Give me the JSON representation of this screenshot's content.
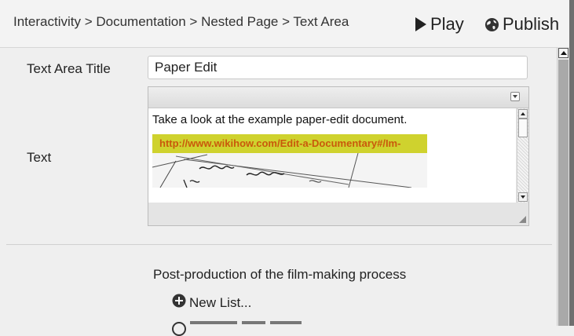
{
  "header": {
    "breadcrumb": "Interactivity > Documentation > Nested Page > Text Area",
    "play_label": "Play",
    "publish_label": "Publish"
  },
  "form": {
    "title_label": "Text Area Title",
    "title_value": "Paper Edit",
    "text_label": "Text"
  },
  "editor": {
    "content_text": "Take a look at the example paper-edit document.",
    "link_text": "http://www.wikihow.com/Edit-a-Documentary#/Im-"
  },
  "list_section": {
    "heading": "Post-production of the film-making process",
    "new_list_label": "New List..."
  },
  "colors": {
    "link_strip": "#cfd22e",
    "link_text": "#c9590b",
    "scroll_thumb": "#a9a9a9"
  },
  "icons": [
    "play-icon",
    "globe-icon",
    "dropdown-icon",
    "plus-circle-icon",
    "resize-grip-icon"
  ]
}
